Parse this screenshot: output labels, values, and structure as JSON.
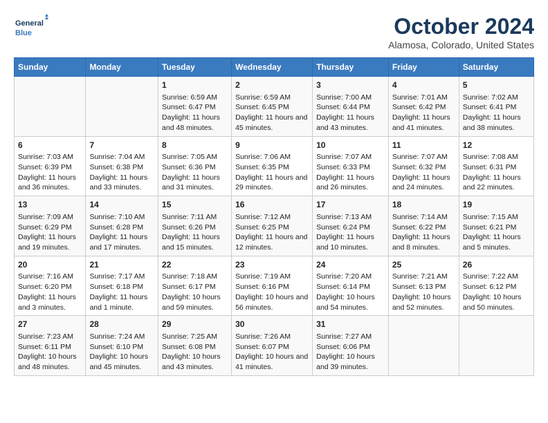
{
  "header": {
    "logo_line1": "General",
    "logo_line2": "Blue",
    "title": "October 2024",
    "subtitle": "Alamosa, Colorado, United States"
  },
  "columns": [
    "Sunday",
    "Monday",
    "Tuesday",
    "Wednesday",
    "Thursday",
    "Friday",
    "Saturday"
  ],
  "rows": [
    [
      {
        "day": "",
        "info": ""
      },
      {
        "day": "",
        "info": ""
      },
      {
        "day": "1",
        "info": "Sunrise: 6:59 AM\nSunset: 6:47 PM\nDaylight: 11 hours and 48 minutes."
      },
      {
        "day": "2",
        "info": "Sunrise: 6:59 AM\nSunset: 6:45 PM\nDaylight: 11 hours and 45 minutes."
      },
      {
        "day": "3",
        "info": "Sunrise: 7:00 AM\nSunset: 6:44 PM\nDaylight: 11 hours and 43 minutes."
      },
      {
        "day": "4",
        "info": "Sunrise: 7:01 AM\nSunset: 6:42 PM\nDaylight: 11 hours and 41 minutes."
      },
      {
        "day": "5",
        "info": "Sunrise: 7:02 AM\nSunset: 6:41 PM\nDaylight: 11 hours and 38 minutes."
      }
    ],
    [
      {
        "day": "6",
        "info": "Sunrise: 7:03 AM\nSunset: 6:39 PM\nDaylight: 11 hours and 36 minutes."
      },
      {
        "day": "7",
        "info": "Sunrise: 7:04 AM\nSunset: 6:38 PM\nDaylight: 11 hours and 33 minutes."
      },
      {
        "day": "8",
        "info": "Sunrise: 7:05 AM\nSunset: 6:36 PM\nDaylight: 11 hours and 31 minutes."
      },
      {
        "day": "9",
        "info": "Sunrise: 7:06 AM\nSunset: 6:35 PM\nDaylight: 11 hours and 29 minutes."
      },
      {
        "day": "10",
        "info": "Sunrise: 7:07 AM\nSunset: 6:33 PM\nDaylight: 11 hours and 26 minutes."
      },
      {
        "day": "11",
        "info": "Sunrise: 7:07 AM\nSunset: 6:32 PM\nDaylight: 11 hours and 24 minutes."
      },
      {
        "day": "12",
        "info": "Sunrise: 7:08 AM\nSunset: 6:31 PM\nDaylight: 11 hours and 22 minutes."
      }
    ],
    [
      {
        "day": "13",
        "info": "Sunrise: 7:09 AM\nSunset: 6:29 PM\nDaylight: 11 hours and 19 minutes."
      },
      {
        "day": "14",
        "info": "Sunrise: 7:10 AM\nSunset: 6:28 PM\nDaylight: 11 hours and 17 minutes."
      },
      {
        "day": "15",
        "info": "Sunrise: 7:11 AM\nSunset: 6:26 PM\nDaylight: 11 hours and 15 minutes."
      },
      {
        "day": "16",
        "info": "Sunrise: 7:12 AM\nSunset: 6:25 PM\nDaylight: 11 hours and 12 minutes."
      },
      {
        "day": "17",
        "info": "Sunrise: 7:13 AM\nSunset: 6:24 PM\nDaylight: 11 hours and 10 minutes."
      },
      {
        "day": "18",
        "info": "Sunrise: 7:14 AM\nSunset: 6:22 PM\nDaylight: 11 hours and 8 minutes."
      },
      {
        "day": "19",
        "info": "Sunrise: 7:15 AM\nSunset: 6:21 PM\nDaylight: 11 hours and 5 minutes."
      }
    ],
    [
      {
        "day": "20",
        "info": "Sunrise: 7:16 AM\nSunset: 6:20 PM\nDaylight: 11 hours and 3 minutes."
      },
      {
        "day": "21",
        "info": "Sunrise: 7:17 AM\nSunset: 6:18 PM\nDaylight: 11 hours and 1 minute."
      },
      {
        "day": "22",
        "info": "Sunrise: 7:18 AM\nSunset: 6:17 PM\nDaylight: 10 hours and 59 minutes."
      },
      {
        "day": "23",
        "info": "Sunrise: 7:19 AM\nSunset: 6:16 PM\nDaylight: 10 hours and 56 minutes."
      },
      {
        "day": "24",
        "info": "Sunrise: 7:20 AM\nSunset: 6:14 PM\nDaylight: 10 hours and 54 minutes."
      },
      {
        "day": "25",
        "info": "Sunrise: 7:21 AM\nSunset: 6:13 PM\nDaylight: 10 hours and 52 minutes."
      },
      {
        "day": "26",
        "info": "Sunrise: 7:22 AM\nSunset: 6:12 PM\nDaylight: 10 hours and 50 minutes."
      }
    ],
    [
      {
        "day": "27",
        "info": "Sunrise: 7:23 AM\nSunset: 6:11 PM\nDaylight: 10 hours and 48 minutes."
      },
      {
        "day": "28",
        "info": "Sunrise: 7:24 AM\nSunset: 6:10 PM\nDaylight: 10 hours and 45 minutes."
      },
      {
        "day": "29",
        "info": "Sunrise: 7:25 AM\nSunset: 6:08 PM\nDaylight: 10 hours and 43 minutes."
      },
      {
        "day": "30",
        "info": "Sunrise: 7:26 AM\nSunset: 6:07 PM\nDaylight: 10 hours and 41 minutes."
      },
      {
        "day": "31",
        "info": "Sunrise: 7:27 AM\nSunset: 6:06 PM\nDaylight: 10 hours and 39 minutes."
      },
      {
        "day": "",
        "info": ""
      },
      {
        "day": "",
        "info": ""
      }
    ]
  ]
}
